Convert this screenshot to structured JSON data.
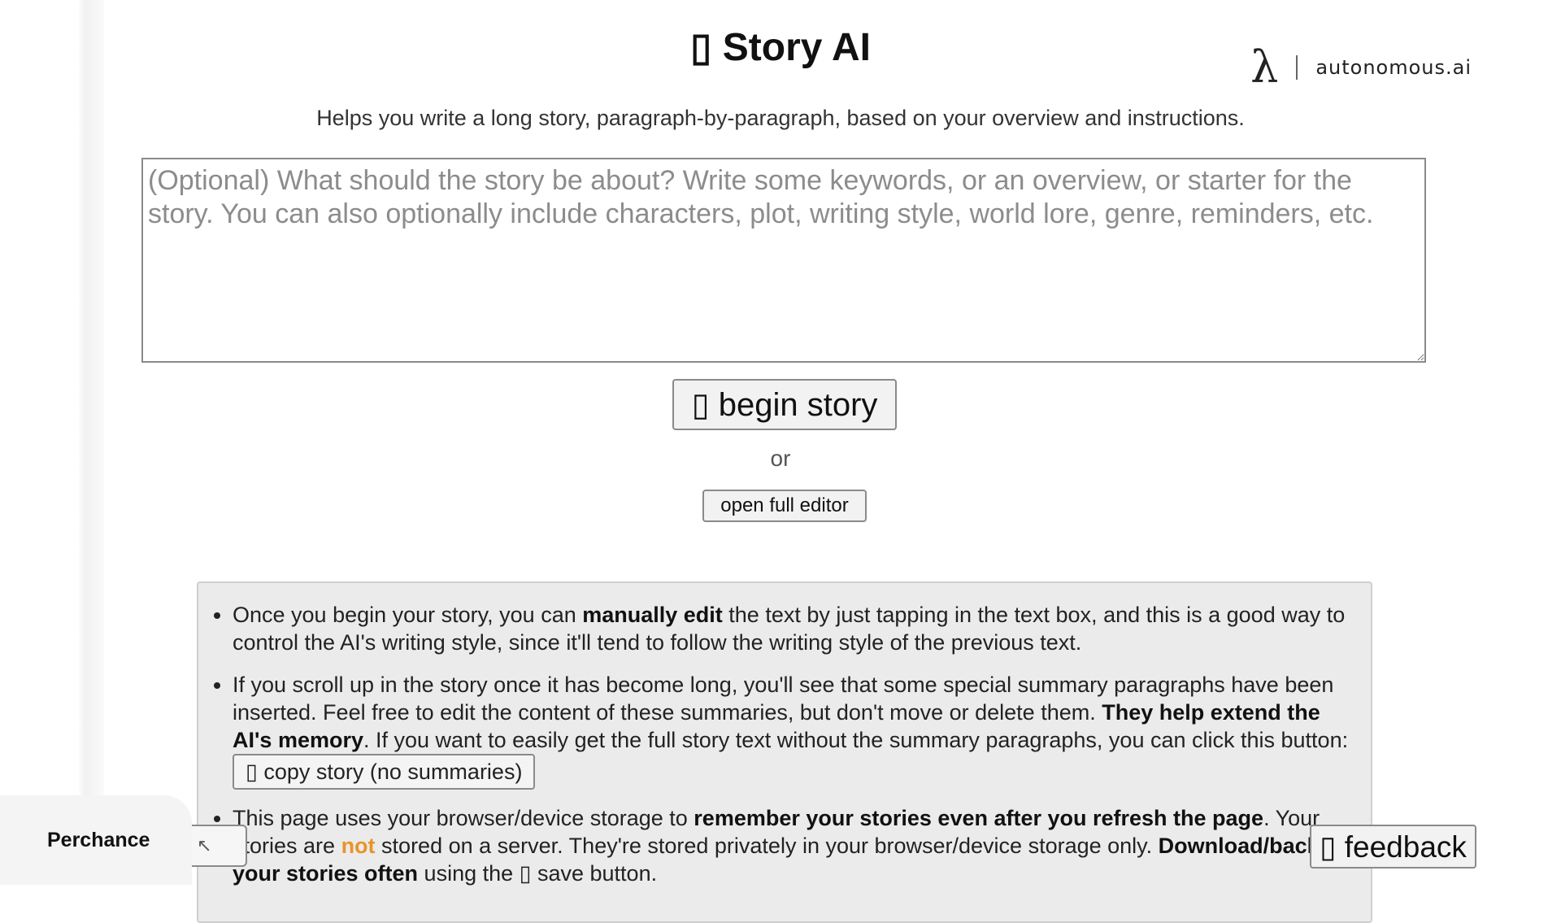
{
  "header": {
    "title": "▯ Story AI",
    "subtitle": "Helps you write a long story, paragraph-by-paragraph, based on your overview and instructions."
  },
  "brand": {
    "logo_glyph": "λ",
    "name": "autonomous.ai"
  },
  "overview_input": {
    "value": "",
    "placeholder": "(Optional) What should the story be about? Write some keywords, or an overview, or starter for the story. You can also optionally include characters, plot, writing style, world lore, genre, reminders, etc."
  },
  "actions": {
    "begin_label": "▯ begin story",
    "or_text": "or",
    "full_editor_label": "open full editor"
  },
  "info": {
    "item1": {
      "t1": "Once you begin your story, you can ",
      "b1": "manually edit",
      "t2": " the text by just tapping in the text box, and this is a good way to control the AI's writing style, since it'll tend to follow the writing style of the previous text."
    },
    "item2": {
      "t1": "If you scroll up in the story once it has become long, you'll see that some special summary paragraphs have been inserted. Feel free to edit the content of these summaries, but don't move or delete them. ",
      "b1": "They help extend the AI's memory",
      "t2": ". If you want to easily get the full story text without the summary paragraphs, you can click this button: ",
      "button_label": "▯ copy story (no summaries)"
    },
    "item3": {
      "t1": "This page uses your browser/device storage to ",
      "b1": "remember your stories even after you refresh the page",
      "t2": ". Your stories are ",
      "not_word": "not",
      "t3": " stored on a server. They're stored privately in your browser/device storage only. ",
      "b2": "Download/backup your stories often",
      "t4": " using the ▯ save button."
    }
  },
  "footer": {
    "perchance_label": "Perchance",
    "collapse_glyph": "↖",
    "feedback_label": "▯ feedback"
  },
  "colors": {
    "accent_not": "#e8942c",
    "info_bg": "#ebebeb"
  }
}
